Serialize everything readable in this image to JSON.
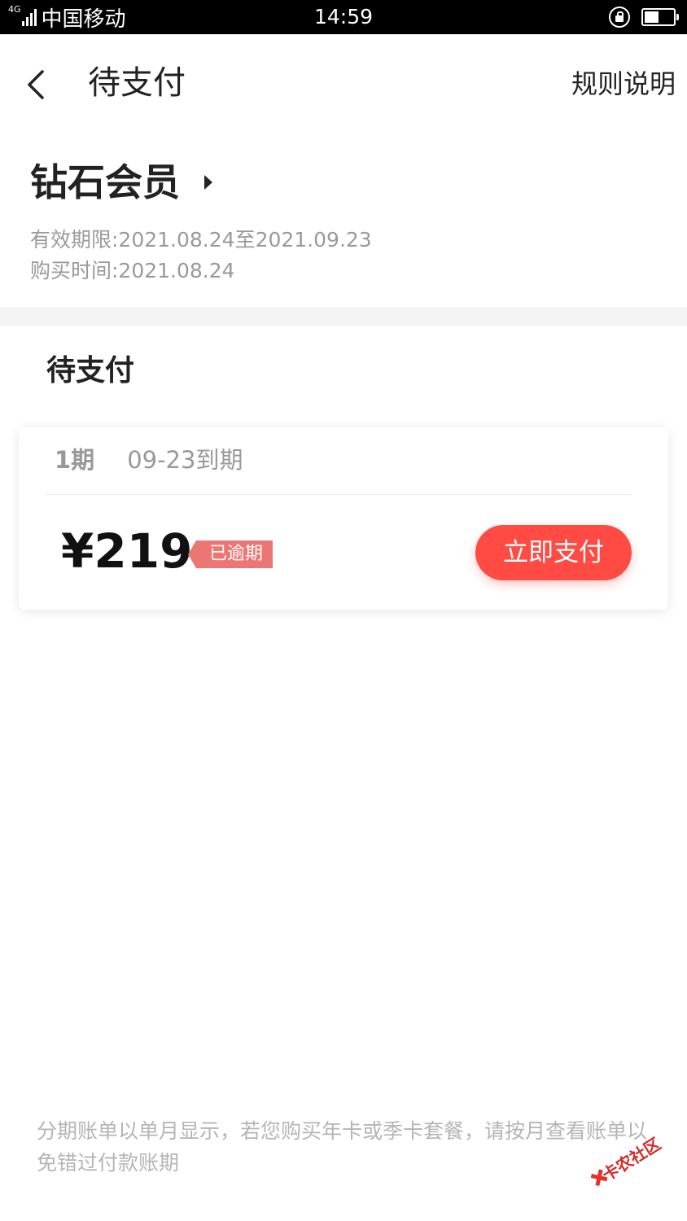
{
  "status_bar": {
    "network_type": "4G",
    "carrier": "中国移动",
    "time": "14:59",
    "battery_level": 0.5,
    "icons": [
      "signal-icon",
      "rotation-lock-icon",
      "battery-icon"
    ]
  },
  "nav": {
    "title": "待支付",
    "rules_label": "规则说明",
    "back_icon": "chevron-left-icon"
  },
  "member": {
    "name": "钻石会员",
    "validity": "有效期限:2021.08.24至2021.09.23",
    "purchase_time": "购买时间:2021.08.24"
  },
  "pending": {
    "heading": "待支付",
    "installments": [
      {
        "period": "1期",
        "due": "09-23到期",
        "amount": "¥219",
        "status_badge": "已逾期",
        "pay_label": "立即支付"
      }
    ]
  },
  "footer": {
    "note": "分期账单以单月显示，若您购买年卡或季卡套餐，请按月查看账单以免错过付款账期"
  },
  "watermark": {
    "text": "卡农社区"
  },
  "colors": {
    "accent": "#ff4b44",
    "badge": "#ec7673",
    "muted_text": "#9a9a9a",
    "section_gap": "#f4f4f4"
  }
}
